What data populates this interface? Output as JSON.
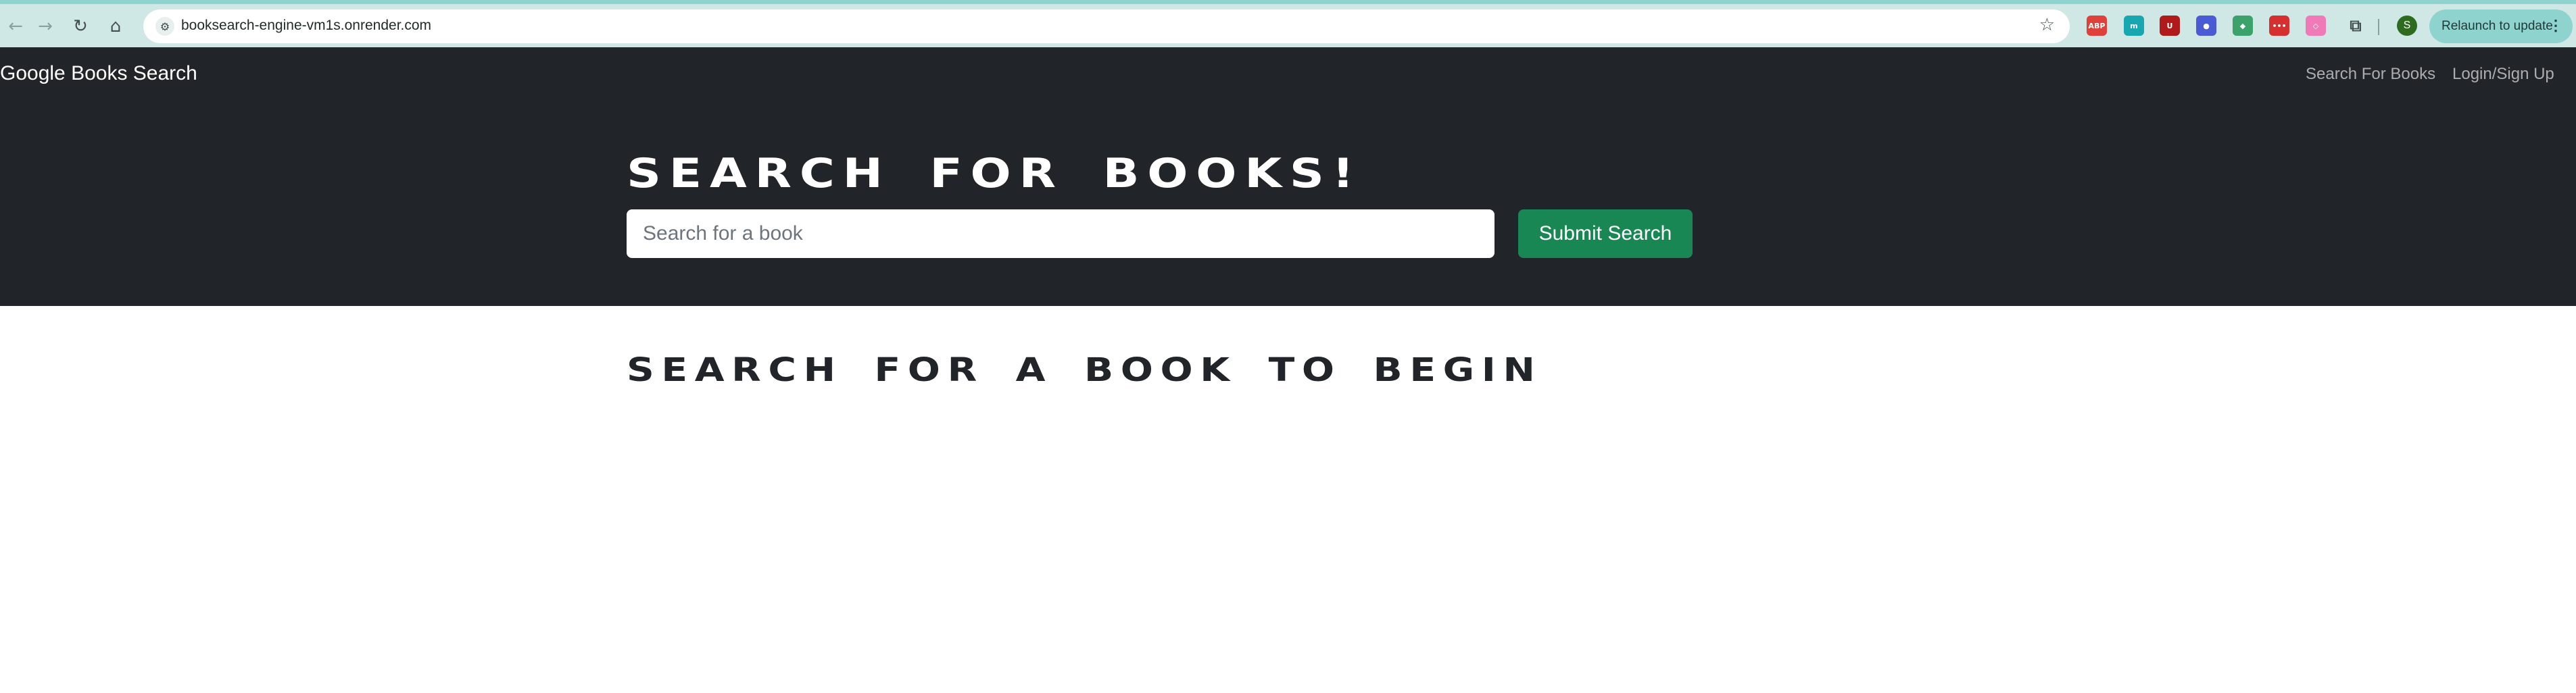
{
  "browser": {
    "url": "booksearch-engine-vm1s.onrender.com",
    "relaunch_label": "Relaunch to update",
    "profile_initial": "S",
    "extensions": [
      {
        "name": "adblock-plus-icon",
        "text": "ABP",
        "color": "#e0403a"
      },
      {
        "name": "m-extension-icon",
        "text": "m",
        "color": "#18a6b0"
      },
      {
        "name": "ublock-origin-icon",
        "text": "U",
        "color": "#b01a1a"
      },
      {
        "name": "globe-extension-icon",
        "text": "●",
        "color": "#4b5bd6"
      },
      {
        "name": "shield-extension-icon",
        "text": "◆",
        "color": "#3aa26a"
      },
      {
        "name": "dots-extension-icon",
        "text": "•••",
        "color": "#d62f2f"
      },
      {
        "name": "pink-extension-icon",
        "text": "◇",
        "color": "#f07ab8"
      }
    ]
  },
  "navbar": {
    "brand": "Google Books Search",
    "links": [
      "Search For Books",
      "Login/Sign Up"
    ]
  },
  "hero": {
    "title": "Search for Books!",
    "search_placeholder": "Search for a book",
    "submit_label": "Submit Search"
  },
  "results": {
    "heading": "Search for a book to begin"
  },
  "colors": {
    "dark_bg": "#212529",
    "submit_green": "#198754"
  }
}
